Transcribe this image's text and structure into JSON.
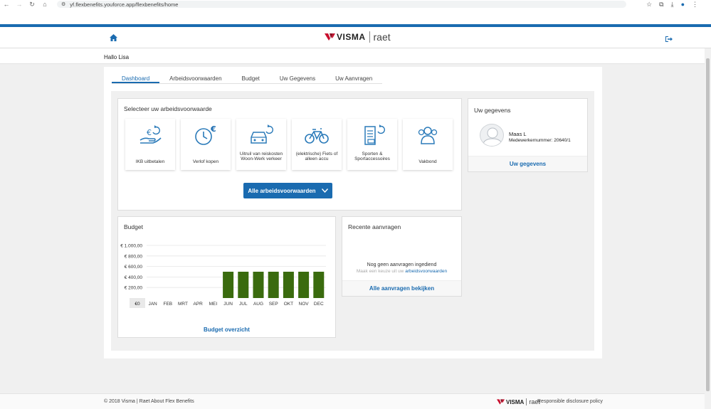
{
  "browser": {
    "url": "yf.flexbenefits.youforce.app/flexbenefits/home"
  },
  "header": {
    "logo_brand": "VISMA",
    "logo_sub": "raet"
  },
  "greeting": "Hallo Lisa",
  "tabs": [
    {
      "label": "Dashboard",
      "active": true
    },
    {
      "label": "Arbeidsvoorwaarden",
      "active": false
    },
    {
      "label": "Budget",
      "active": false
    },
    {
      "label": "Uw Gegevens",
      "active": false
    },
    {
      "label": "Uw Aanvragen",
      "active": false
    }
  ],
  "arbeidsvoorwaarden": {
    "title": "Selecteer uw arbeidsvoorwaarde",
    "tiles": [
      {
        "label": "IKB uitbetalen",
        "icon": "hand-euro-icon"
      },
      {
        "label": "Verlof kopen",
        "icon": "clock-euro-icon"
      },
      {
        "label": "Uitruil van reiskosten Woon-Werk verkeer",
        "icon": "car-exchange-icon"
      },
      {
        "label": "(elektrische) Fiets of alleen accu",
        "icon": "bicycle-icon"
      },
      {
        "label": "Sporten & Sportaccessoires",
        "icon": "document-exchange-icon"
      },
      {
        "label": "Vakbond",
        "icon": "people-icon"
      }
    ],
    "button_label": "Alle arbeidsvoorwaarden"
  },
  "profile": {
    "title": "Uw gegevens",
    "name": "Maas L",
    "employee_number": "Medewerkernummer: 20640/1",
    "link": "Uw gegevens"
  },
  "budget": {
    "title": "Budget",
    "link": "Budget overzicht",
    "zero_label": "€0"
  },
  "chart_data": {
    "type": "bar",
    "categories": [
      "JAN",
      "FEB",
      "MRT",
      "APR",
      "MEI",
      "JUN",
      "JUL",
      "AUG",
      "SEP",
      "OKT",
      "NOV",
      "DEC"
    ],
    "values": [
      0,
      0,
      0,
      0,
      0,
      500,
      500,
      500,
      500,
      500,
      500,
      500
    ],
    "ytick_labels": [
      "€ 200,00",
      "€ 400,00",
      "€ 600,00",
      "€ 800,00",
      "€ 1.000,00"
    ],
    "ytick_values": [
      200,
      400,
      600,
      800,
      1000
    ],
    "ylim": [
      0,
      1000
    ],
    "grid": true,
    "bar_color": "#3a6b0e"
  },
  "recent": {
    "title": "Recente aanvragen",
    "empty": "Nog geen aanvragen ingediend",
    "sub_prefix": "Maak een keuze uit uw",
    "sub_link": "arbeidsvoorwaarden",
    "link": "Alle aanvragen bekijken"
  },
  "footer": {
    "left": "© 2018 Visma | Raet About Flex Benefits",
    "logo_brand": "VISMA",
    "logo_sub": "raet",
    "right": "Responsible disclosure policy"
  },
  "colors": {
    "primary": "#1a6bb0",
    "brand_red": "#c8102e",
    "bar_green": "#3a6b0e"
  }
}
